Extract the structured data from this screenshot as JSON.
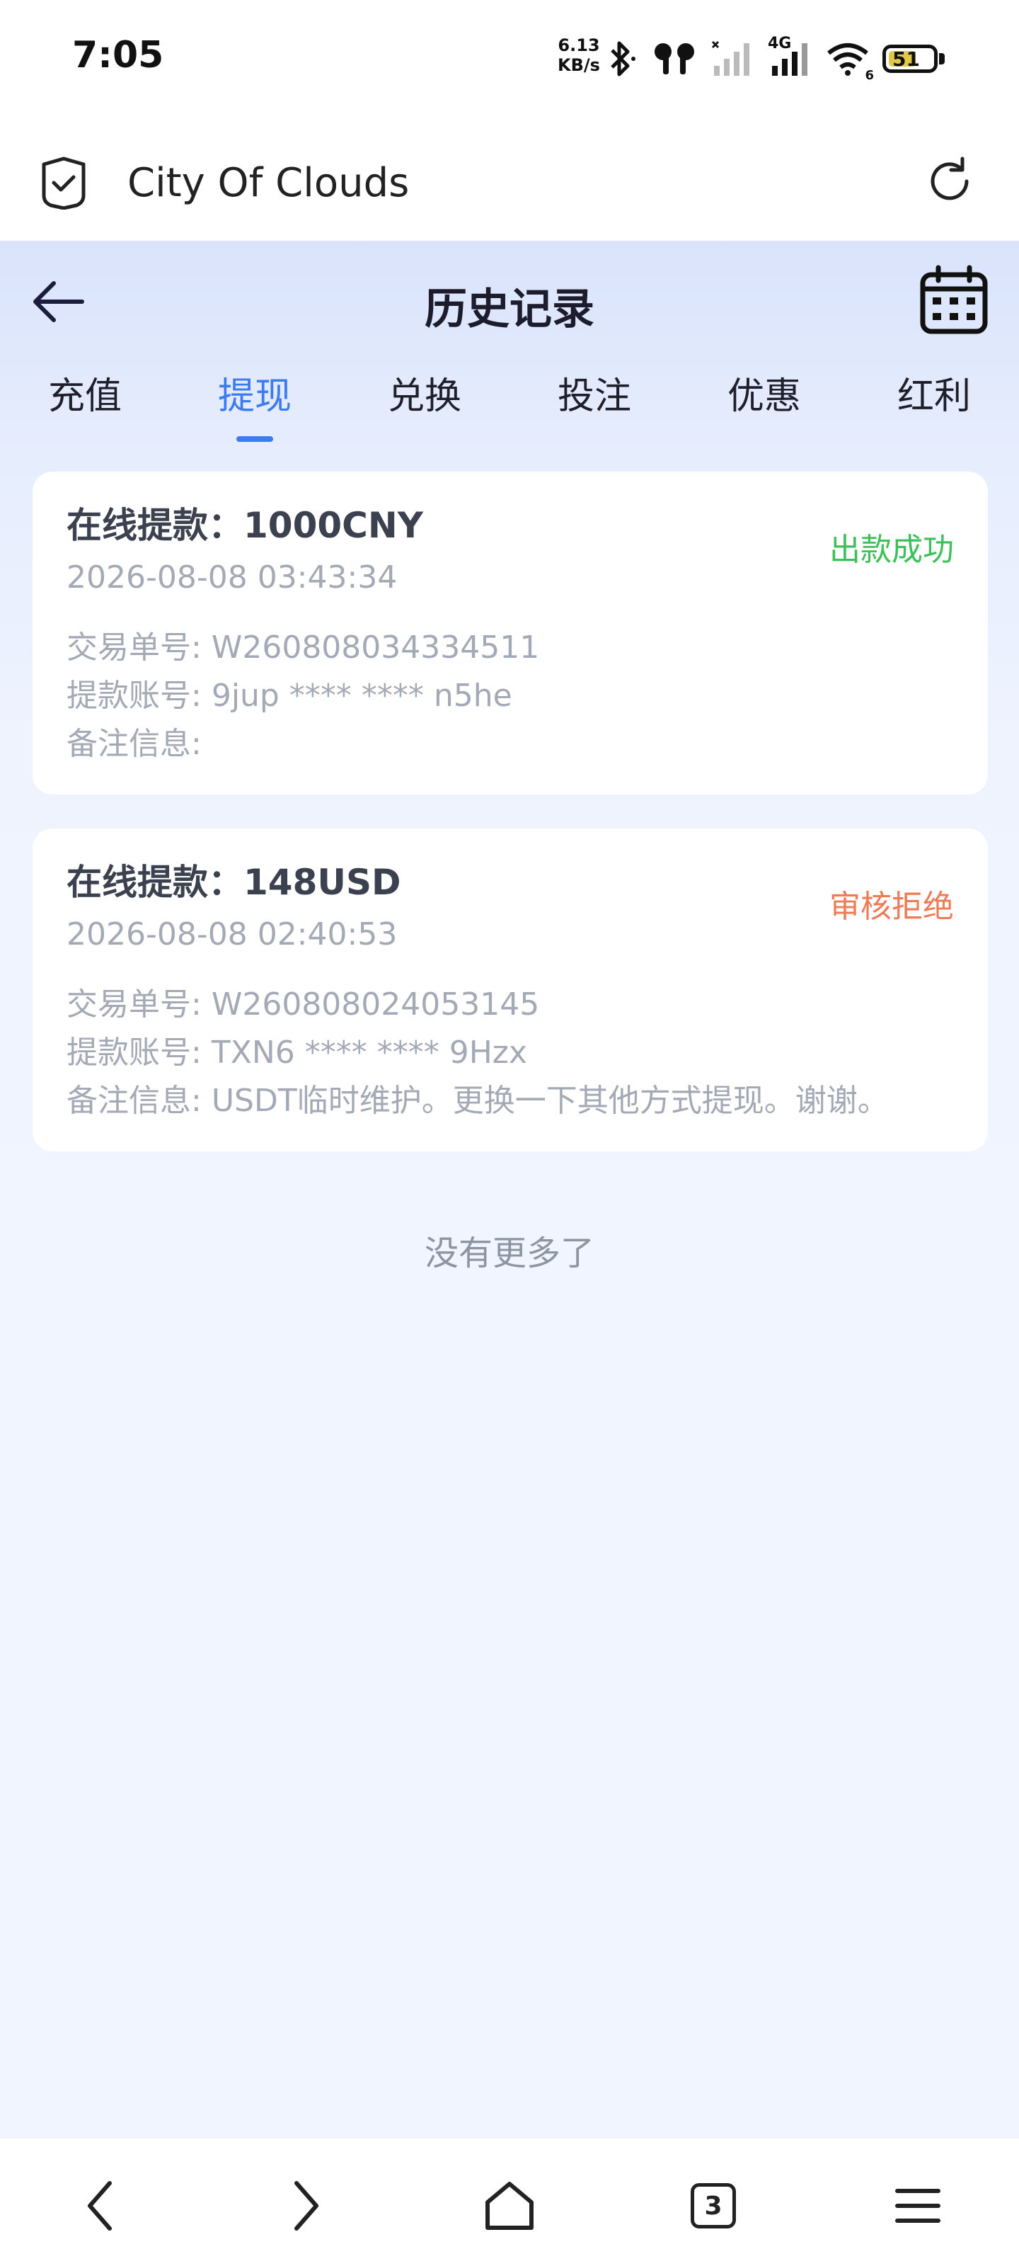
{
  "status_bar": {
    "time": "7:05",
    "net_speed_value": "6.13",
    "net_speed_unit": "KB/s",
    "network_type": "4G",
    "wifi_sub": "6",
    "battery_level": "51",
    "icons": [
      "bluetooth-icon",
      "earbuds-icon",
      "signal-1-icon",
      "signal-2-icon",
      "wifi-icon",
      "battery-icon"
    ]
  },
  "browser": {
    "site_name": "City Of Clouds",
    "icons": [
      "shield-check-icon",
      "reload-icon"
    ]
  },
  "header": {
    "title": "历史记录",
    "icons": [
      "back-arrow-icon",
      "calendar-icon"
    ]
  },
  "tabs": [
    {
      "label": "充值"
    },
    {
      "label": "提现"
    },
    {
      "label": "兑换"
    },
    {
      "label": "投注"
    },
    {
      "label": "优惠"
    },
    {
      "label": "红利"
    }
  ],
  "active_tab": "提现",
  "records": [
    {
      "title": "在线提款：1000CNY",
      "date": "2026-08-08 03:43:34",
      "status": "出款成功",
      "order_label": "交易单号:",
      "order_value": "W260808034334511",
      "account_label": "提款账号:",
      "account_value": "9jup **** **** n5he",
      "note_label": "备注信息:",
      "note_value": ""
    },
    {
      "title": "在线提款：148USD",
      "date": "2026-08-08 02:40:53",
      "status": "审核拒绝",
      "order_label": "交易单号:",
      "order_value": "W260808024053145",
      "account_label": "提款账号:",
      "account_value": "TXN6 **** **** 9Hzx",
      "note_label": "备注信息:",
      "note_value": "USDT临时维护。更换一下其他方式提现。谢谢。"
    }
  ],
  "no_more": "没有更多了",
  "bottom_nav": {
    "tab_count": "3",
    "icons": [
      "back-icon",
      "forward-icon",
      "home-icon",
      "tabs-icon",
      "menu-icon"
    ]
  },
  "colors": {
    "accent": "#3c7bf0",
    "success": "#3dbf5a",
    "rejected": "#ee7b55",
    "header_bg": "#d9e3fb"
  }
}
